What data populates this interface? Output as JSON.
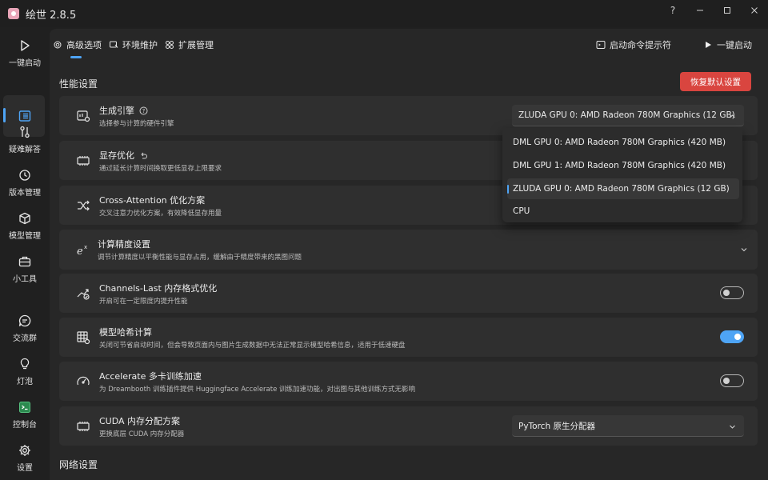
{
  "window": {
    "title": "绘世 2.8.5",
    "help_icon": "?"
  },
  "sidebar": {
    "items": [
      {
        "label": "一键启动",
        "icon": "play-icon"
      },
      {
        "label": "",
        "icon": "list-icon"
      },
      {
        "label": "疑难解答",
        "icon": "tools-icon"
      },
      {
        "label": "版本管理",
        "icon": "history-icon"
      },
      {
        "label": "模型管理",
        "icon": "cube-icon"
      },
      {
        "label": "小工具",
        "icon": "toolbox-icon"
      },
      {
        "label": "交流群",
        "icon": "chat-icon"
      },
      {
        "label": "灯泡",
        "icon": "bulb-icon"
      },
      {
        "label": "控制台",
        "icon": "console-icon"
      },
      {
        "label": "设置",
        "icon": "gear-icon"
      }
    ]
  },
  "tabs": [
    {
      "label": "高级选项"
    },
    {
      "label": "环境维护"
    },
    {
      "label": "扩展管理"
    }
  ],
  "toolbar": {
    "command_prompt": "启动命令提示符",
    "launch": "一键启动"
  },
  "sections": {
    "performance": "性能设置",
    "network": "网络设置"
  },
  "reset_button": "恢复默认设置",
  "settings": {
    "engine": {
      "title": "生成引擎",
      "desc": "选择参与计算的硬件引擎",
      "value": "ZLUDA GPU 0: AMD Radeon 780M Graphics (12 GB)"
    },
    "vram": {
      "title": "显存优化",
      "desc": "通过延长计算时间换取更低显存上限要求"
    },
    "cross_attention": {
      "title": "Cross-Attention 优化方案",
      "desc": "交叉注意力优化方案，有效降低显存用量"
    },
    "precision": {
      "title": "计算精度设置",
      "desc": "调节计算精度以平衡性能与显存占用，缓解由于精度带来的黑图问题"
    },
    "channels_last": {
      "title": "Channels-Last 内存格式优化",
      "desc": "开启可在一定限度内提升性能",
      "enabled": false
    },
    "model_hash": {
      "title": "模型哈希计算",
      "desc": "关闭可节省启动时间，但会导致页面内与图片生成数据中无法正常显示模型哈希信息，适用于低速硬盘",
      "enabled": true
    },
    "accelerate": {
      "title": "Accelerate 多卡训练加速",
      "desc": "为 Dreambooth 训练插件提供 Huggingface Accelerate 训练加速功能，对出图与其他训练方式无影响",
      "enabled": false
    },
    "cuda_alloc": {
      "title": "CUDA 内存分配方案",
      "desc": "更换底层 CUDA 内存分配器",
      "value": "PyTorch 原生分配器"
    }
  },
  "dropdown_options": [
    {
      "label": "DML GPU 0: AMD Radeon 780M Graphics (420 MB)"
    },
    {
      "label": "DML GPU 1: AMD Radeon 780M Graphics (420 MB)"
    },
    {
      "label": "ZLUDA GPU 0: AMD Radeon 780M Graphics (12 GB)",
      "selected": true
    },
    {
      "label": "CPU"
    }
  ],
  "colors": {
    "accent": "#4ea4f5",
    "danger": "#d9453f",
    "background": "#202020",
    "card": "#2f2f2f"
  }
}
